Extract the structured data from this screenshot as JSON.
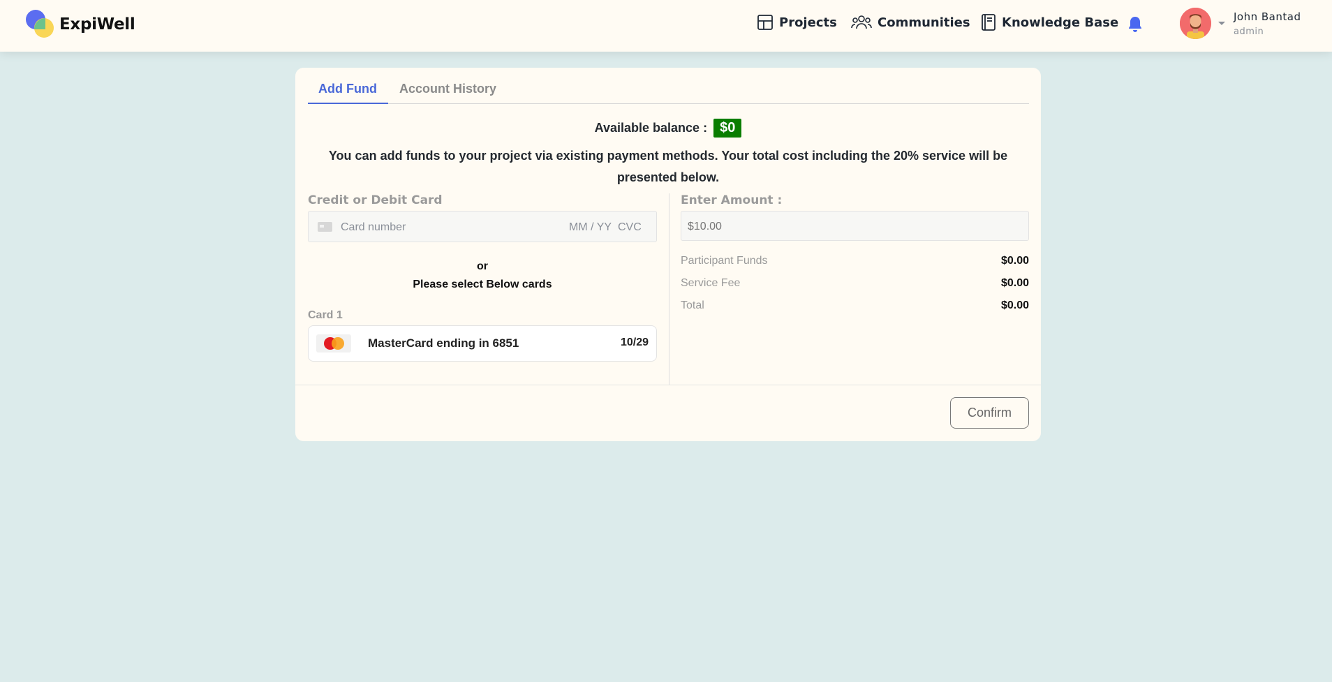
{
  "header": {
    "logo_text": "ExpiWell",
    "nav": {
      "projects": "Projects",
      "communities": "Communities",
      "knowledge_base": "Knowledge Base"
    },
    "user": {
      "name": "John Bantad",
      "role": "admin"
    }
  },
  "tabs": {
    "add_fund": "Add Fund",
    "account_history": "Account History",
    "active": "Add Fund"
  },
  "balance": {
    "label": "Available balance :",
    "value": "$0"
  },
  "info_text": "You can add funds to your project via existing payment methods. Your total cost including the 20% service will be presented below.",
  "payment": {
    "section_label": "Credit or Debit Card",
    "card_number_placeholder": "Card number",
    "expiry_placeholder": "MM / YY",
    "cvc_placeholder": "CVC",
    "or_text": "or",
    "select_text": "Please select Below cards",
    "saved_cards": [
      {
        "label": "Card 1",
        "brand_icon": "mastercard-icon",
        "name": "MasterCard ending in 6851",
        "expiry": "10/29"
      }
    ]
  },
  "amount": {
    "label": "Enter Amount :",
    "placeholder": "$10.00",
    "rows": [
      {
        "label": "Participant Funds",
        "value": "$0.00"
      },
      {
        "label": "Service Fee",
        "value": "$0.00"
      },
      {
        "label": "Total",
        "value": "$0.00"
      }
    ]
  },
  "confirm_label": "Confirm",
  "colors": {
    "accent": "#4a68d8",
    "balance_badge": "#0a7d00",
    "page_bg": "#dcebeb",
    "card_bg": "#fffbf3",
    "bell": "#4a68f0"
  }
}
